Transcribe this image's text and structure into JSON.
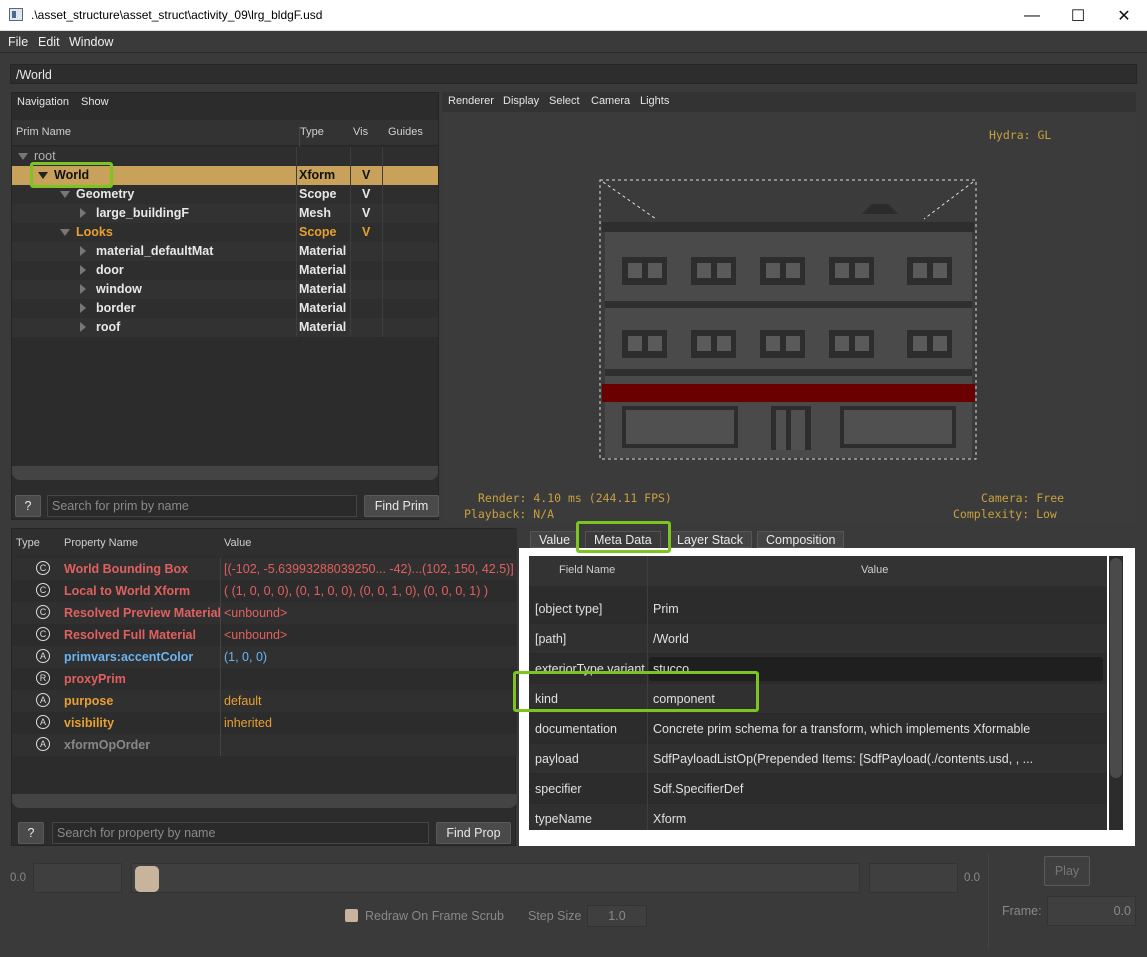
{
  "window": {
    "title": ".\\asset_structure\\asset_struct\\activity_09\\lrg_bldgF.usd",
    "minimize": "—",
    "maximize": "☐",
    "close": "✕"
  },
  "menu": [
    "File",
    "Edit",
    "Window"
  ],
  "path": "/World",
  "nav": {
    "menus": [
      "Navigation",
      "Show"
    ],
    "columns": [
      "Prim Name",
      "Type",
      "Vis",
      "Guides"
    ]
  },
  "tree": [
    {
      "name": "root",
      "type": "",
      "vis": "",
      "expand": "down",
      "color": "#b0b0b0"
    },
    {
      "name": "World",
      "type": "Xform",
      "vis": "V",
      "expand": "down",
      "color": "#111111"
    },
    {
      "name": "Geometry",
      "type": "Scope",
      "vis": "V",
      "expand": "down",
      "color": "#e8e8e8"
    },
    {
      "name": "large_buildingF",
      "type": "Mesh",
      "vis": "V",
      "expand": "right",
      "color": "#e8e8e8"
    },
    {
      "name": "Looks",
      "type": "Scope",
      "vis": "V",
      "expand": "down",
      "color": "#e8a030"
    },
    {
      "name": "material_defaultMat",
      "type": "Material",
      "vis": "",
      "expand": "right",
      "color": "#e8e8e8"
    },
    {
      "name": "door",
      "type": "Material",
      "vis": "",
      "expand": "right",
      "color": "#e8e8e8"
    },
    {
      "name": "window",
      "type": "Material",
      "vis": "",
      "expand": "right",
      "color": "#e8e8e8"
    },
    {
      "name": "border",
      "type": "Material",
      "vis": "",
      "expand": "right",
      "color": "#e8e8e8"
    },
    {
      "name": "roof",
      "type": "Material",
      "vis": "",
      "expand": "right",
      "color": "#e8e8e8"
    }
  ],
  "prim_search": {
    "help": "?",
    "placeholder": "Search for prim by name",
    "button": "Find Prim"
  },
  "viewport": {
    "menus": [
      "Renderer",
      "Display",
      "Select",
      "Camera",
      "Lights"
    ],
    "hydra": "Hydra: GL",
    "render": "Render: 4.10 ms (244.11 FPS)",
    "playback": "Playback: N/A",
    "camera": "Camera: Free",
    "complexity": "Complexity: Low",
    "colors": {
      "background": "#3b3b3b",
      "facade": "#4a4a4a",
      "trim": "#2e2e2e",
      "awning": "#6b0000",
      "hud": "#c8a040"
    }
  },
  "props": {
    "columns": [
      "Type",
      "Property Name",
      "Value"
    ],
    "rows": [
      {
        "icon": "C",
        "name": "World Bounding Box",
        "value": "[(-102, -5.63993288039250... -42)...(102, 150, 42.5)]",
        "color": "#e06060"
      },
      {
        "icon": "C",
        "name": "Local to World Xform",
        "value": "( (1, 0, 0, 0), (0, 1, 0, 0), (0, 0, 1, 0), (0, 0, 0, 1) )",
        "color": "#e06060"
      },
      {
        "icon": "C",
        "name": "Resolved Preview Material",
        "value": "<unbound>",
        "color": "#e06060"
      },
      {
        "icon": "C",
        "name": "Resolved Full Material",
        "value": "<unbound>",
        "color": "#e06060"
      },
      {
        "icon": "A",
        "name": "primvars:accentColor",
        "value": "(1, 0, 0)",
        "color": "#6ab4f0"
      },
      {
        "icon": "R",
        "name": "proxyPrim",
        "value": "",
        "color": "#e06060"
      },
      {
        "icon": "A",
        "name": "purpose",
        "value": "default",
        "color": "#e8a030"
      },
      {
        "icon": "A",
        "name": "visibility",
        "value": "inherited",
        "color": "#e8a030"
      },
      {
        "icon": "A",
        "name": "xformOpOrder",
        "value": "",
        "color": "#888888"
      }
    ],
    "search": {
      "help": "?",
      "placeholder": "Search for property by name",
      "button": "Find Prop"
    }
  },
  "tabs": [
    "Value",
    "Meta Data",
    "Layer Stack",
    "Composition"
  ],
  "metadata": {
    "columns": [
      "Field Name",
      "Value"
    ],
    "rows": [
      {
        "field": "[object type]",
        "value": "Prim"
      },
      {
        "field": "[path]",
        "value": "/World"
      },
      {
        "field": "exteriorType variant",
        "value": "stucco"
      },
      {
        "field": "kind",
        "value": "component"
      },
      {
        "field": "documentation",
        "value": "Concrete prim schema for a transform, which implements Xformable"
      },
      {
        "field": "payload",
        "value": "SdfPayloadListOp(Prepended Items: [SdfPayload(./contents.usd, , ..."
      },
      {
        "field": "specifier",
        "value": "Sdf.SpecifierDef"
      },
      {
        "field": "typeName",
        "value": "Xform"
      }
    ]
  },
  "timeline": {
    "start": "0.0",
    "end": "0.0",
    "play": "Play",
    "frame_label": "Frame:",
    "frame": "0.0",
    "redraw": "Redraw On Frame Scrub",
    "step_label": "Step Size",
    "step": "1.0"
  },
  "highlight_color": "#7cc41f"
}
